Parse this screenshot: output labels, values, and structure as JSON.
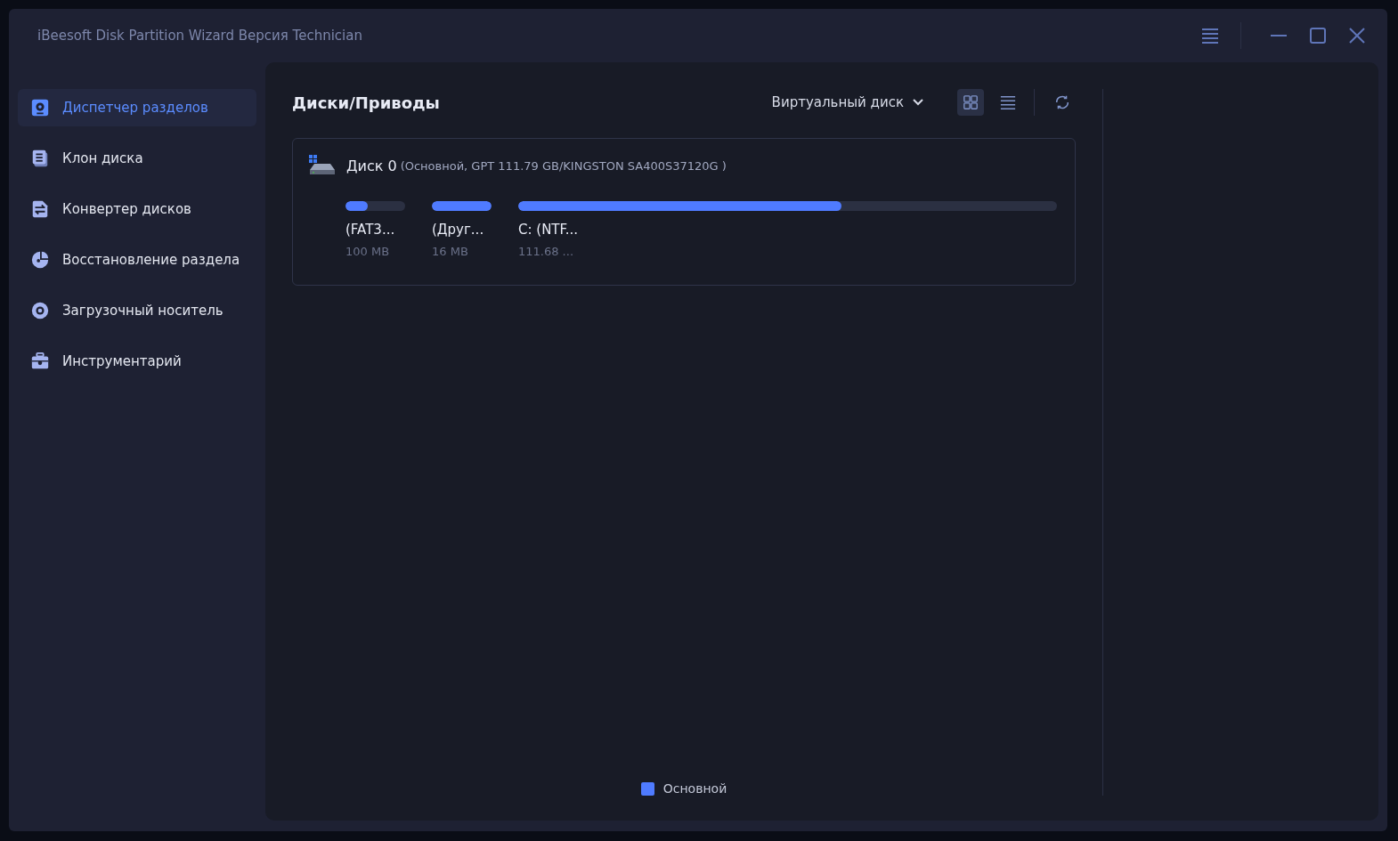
{
  "window": {
    "title": "iBeesoft Disk Partition Wizard Версия Technician"
  },
  "sidebar": {
    "items": [
      {
        "label": "Диспетчер разделов",
        "kind": "partition",
        "selected": true
      },
      {
        "label": "Клон диска",
        "kind": "clone",
        "selected": false
      },
      {
        "label": "Конвертер дисков",
        "kind": "convert",
        "selected": false
      },
      {
        "label": "Восстановление раздела",
        "kind": "recover",
        "selected": false
      },
      {
        "label": "Загрузочный носитель",
        "kind": "boot",
        "selected": false
      },
      {
        "label": "Инструментарий",
        "kind": "tools",
        "selected": false
      }
    ]
  },
  "header": {
    "title": "Диски/Приводы",
    "dropdown": "Виртуальный диск",
    "views": [
      {
        "kind": "grid",
        "selected": true
      },
      {
        "kind": "list",
        "selected": false
      }
    ]
  },
  "disks": [
    {
      "name": "Диск 0",
      "details": "(Основной, GPT 111.79 GB/KINGSTON SA400S37120G )",
      "partitions": [
        {
          "label": "(FAT3...",
          "size": "100 MB",
          "level": 0.37,
          "wide": false
        },
        {
          "label": "(Друг...",
          "size": "16 MB",
          "level": 1,
          "wide": false
        },
        {
          "label": "C: (NTF...",
          "size": "111.68 ...",
          "level": 0.6,
          "wide": true
        }
      ]
    }
  ],
  "legend": [
    {
      "label": "Основной",
      "color": "#4f7bff"
    }
  ]
}
